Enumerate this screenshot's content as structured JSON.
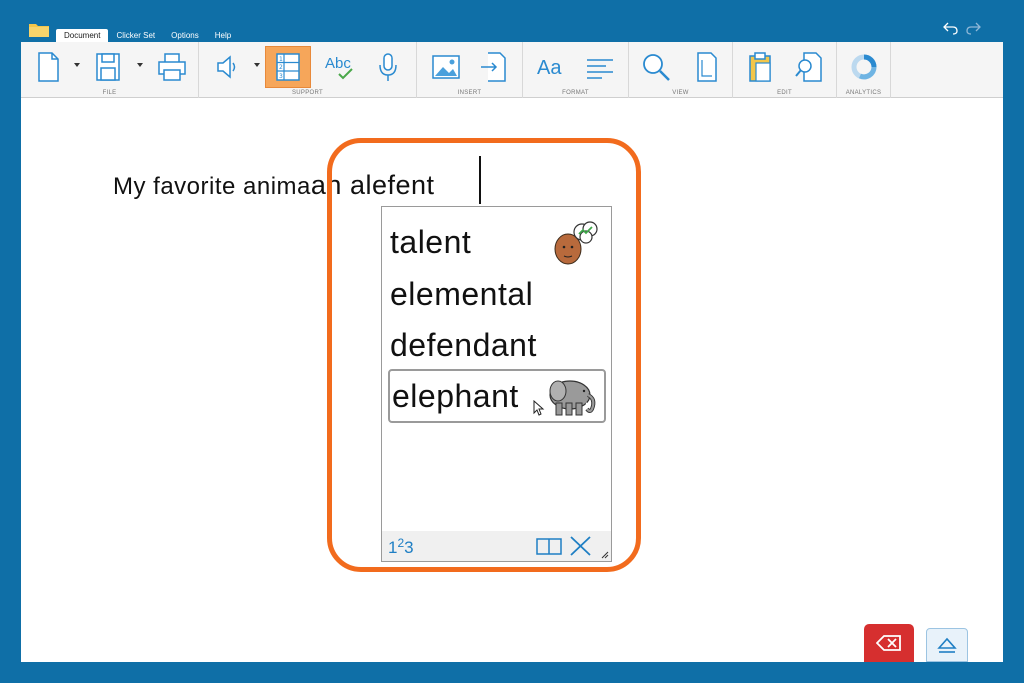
{
  "app": {
    "tabs": [
      "Document",
      "Clicker Set",
      "Options",
      "Help"
    ],
    "active_tab": "Document"
  },
  "ribbon": {
    "groups": {
      "file": "FILE",
      "support": "SUPPORT",
      "insert": "INSERT",
      "format": "FORMAT",
      "view": "VIEW",
      "edit": "EDIT",
      "analytics": "ANALYTICS"
    },
    "format_label": "Aa",
    "spell_label": "Abc"
  },
  "document": {
    "lead_text": "My favorite anima",
    "typed_text": "an alefent"
  },
  "prediction": {
    "items": [
      {
        "word": "talent",
        "symbol": "thinking-face-icon"
      },
      {
        "word": "elemental",
        "symbol": ""
      },
      {
        "word": "defendant",
        "symbol": ""
      },
      {
        "word": "elephant",
        "symbol": "elephant-icon"
      }
    ],
    "selected_index": 3,
    "number_toggle_main": "1",
    "number_toggle_sup": "2",
    "number_toggle_end": "3"
  },
  "colors": {
    "background": "#0f6fa7",
    "highlight": "#f26b1d",
    "backspace": "#d62f2f",
    "accent": "#1f7fc4",
    "active_tool": "#f6a65a"
  }
}
